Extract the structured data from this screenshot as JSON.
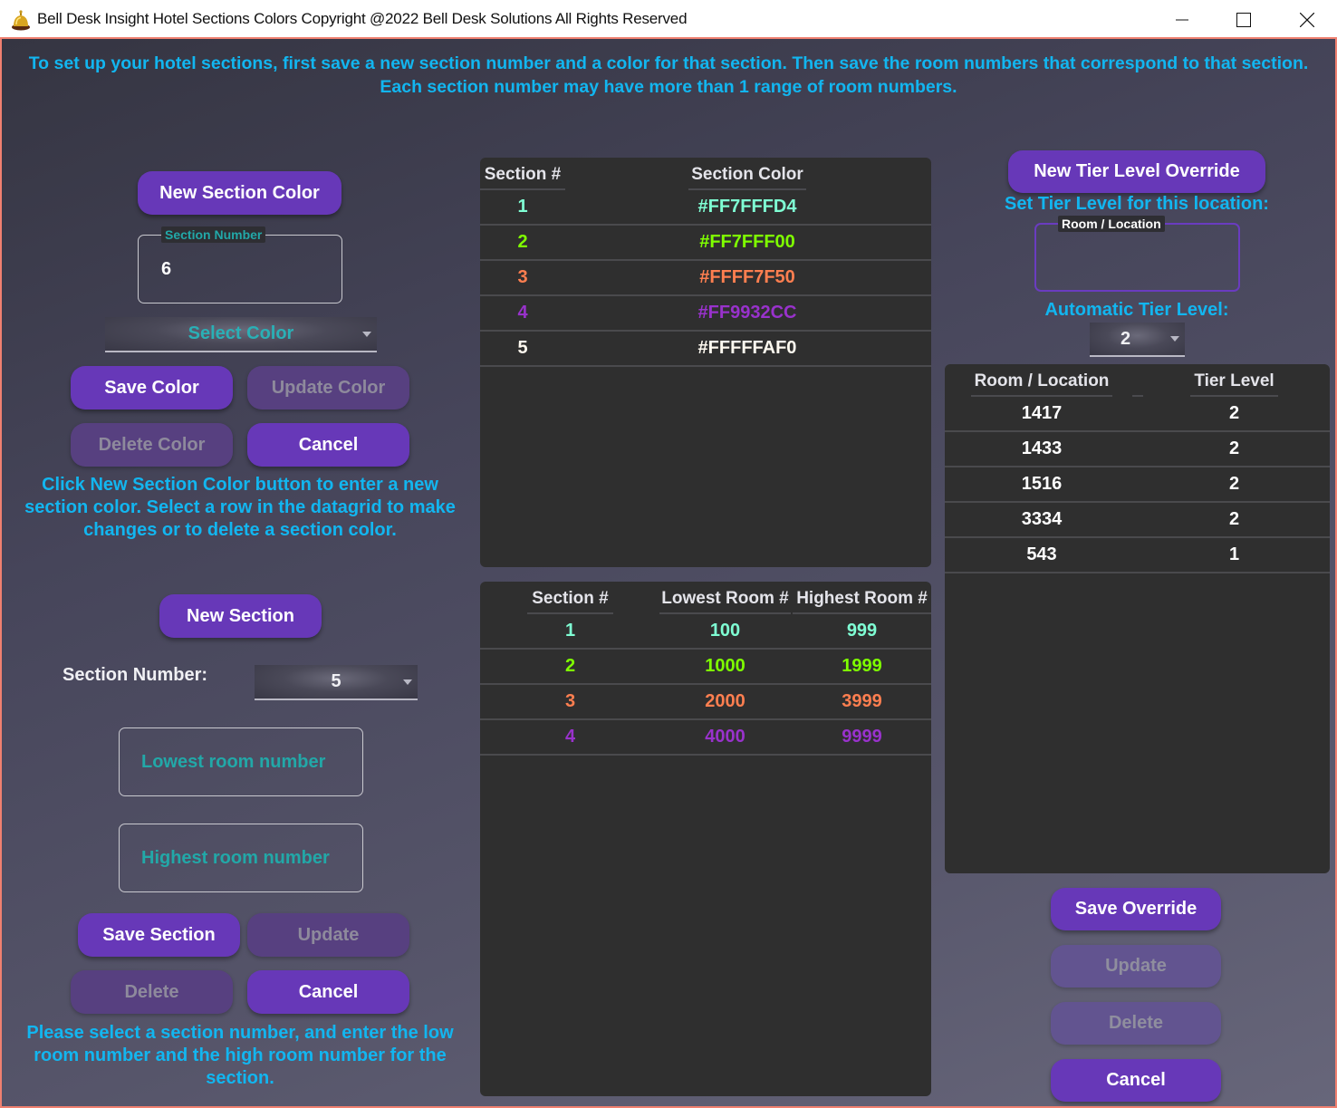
{
  "window": {
    "title": "Bell Desk Insight Hotel Sections Colors Copyright @2022 Bell Desk Solutions All Rights Reserved",
    "icon": "bell-icon",
    "controls": {
      "minimize": "minimize-icon",
      "maximize": "maximize-icon",
      "close": "close-icon"
    }
  },
  "theme": {
    "accent": "#6738B8",
    "accent_disabled": "#574080",
    "info_text": "#12B6F0",
    "placeholder_text": "#22A8A8",
    "grid_background": "#2F2F2F",
    "window_border": "#F08070"
  },
  "instructions": {
    "line1": "To set up your hotel sections, first save a new section number and a color for that section. Then save the room numbers that correspond to that section.",
    "line2": "Each section number may have more than 1 range of room numbers."
  },
  "section_color_panel": {
    "new_button": "New Section Color",
    "section_number_label": "Section Number",
    "section_number_value": "6",
    "color_select_value": "Select Color",
    "save_button": "Save Color",
    "update_button": "Update Color",
    "delete_button": "Delete Color",
    "cancel_button": "Cancel",
    "help_text": "Click New Section Color button to enter a new section color. Select a row in the datagrid to make changes or to delete a section color."
  },
  "section_panel": {
    "new_button": "New Section",
    "section_number_label": "Section Number:",
    "section_number_value": "5",
    "lowest_placeholder": "Lowest room number",
    "highest_placeholder": "Highest room number",
    "save_button": "Save Section",
    "update_button": "Update",
    "delete_button": "Delete",
    "cancel_button": "Cancel",
    "help_text": "Please select a section number, and enter the low room number and the high room number for the section."
  },
  "colors_grid": {
    "columns": [
      "Section #",
      "Section Color"
    ],
    "rows": [
      {
        "section": "1",
        "color": "#FF7FFFD4",
        "display": "#7FFFD4"
      },
      {
        "section": "2",
        "color": "#FF7FFF00",
        "display": "#7FFF00"
      },
      {
        "section": "3",
        "color": "#FFFF7F50",
        "display": "#FF7F50"
      },
      {
        "section": "4",
        "color": "#FF9932CC",
        "display": "#9932CC"
      },
      {
        "section": "5",
        "color": "#FFFFFAF0",
        "display": "#FFFAF0"
      }
    ]
  },
  "ranges_grid": {
    "columns": [
      "Section #",
      "Lowest Room #",
      "Highest Room #"
    ],
    "rows": [
      {
        "section": "1",
        "low": "100",
        "high": "999",
        "display": "#7FFFD4"
      },
      {
        "section": "2",
        "low": "1000",
        "high": "1999",
        "display": "#7FFF00"
      },
      {
        "section": "3",
        "low": "2000",
        "high": "3999",
        "display": "#FF7F50"
      },
      {
        "section": "4",
        "low": "4000",
        "high": "9999",
        "display": "#9932CC"
      }
    ]
  },
  "tier_panel": {
    "new_button": "New Tier Level Override",
    "set_label": "Set Tier Level for this location:",
    "room_field_label": "Room / Location",
    "room_field_value": "",
    "auto_label": "Automatic Tier Level:",
    "auto_value": "2",
    "save_button": "Save Override",
    "update_button": "Update",
    "delete_button": "Delete",
    "cancel_button": "Cancel"
  },
  "tier_grid": {
    "columns": [
      "Room / Location",
      "Tier Level"
    ],
    "rows": [
      {
        "room": "1417",
        "tier": "2"
      },
      {
        "room": "1433",
        "tier": "2"
      },
      {
        "room": "1516",
        "tier": "2"
      },
      {
        "room": "3334",
        "tier": "2"
      },
      {
        "room": "543",
        "tier": "1"
      }
    ]
  }
}
